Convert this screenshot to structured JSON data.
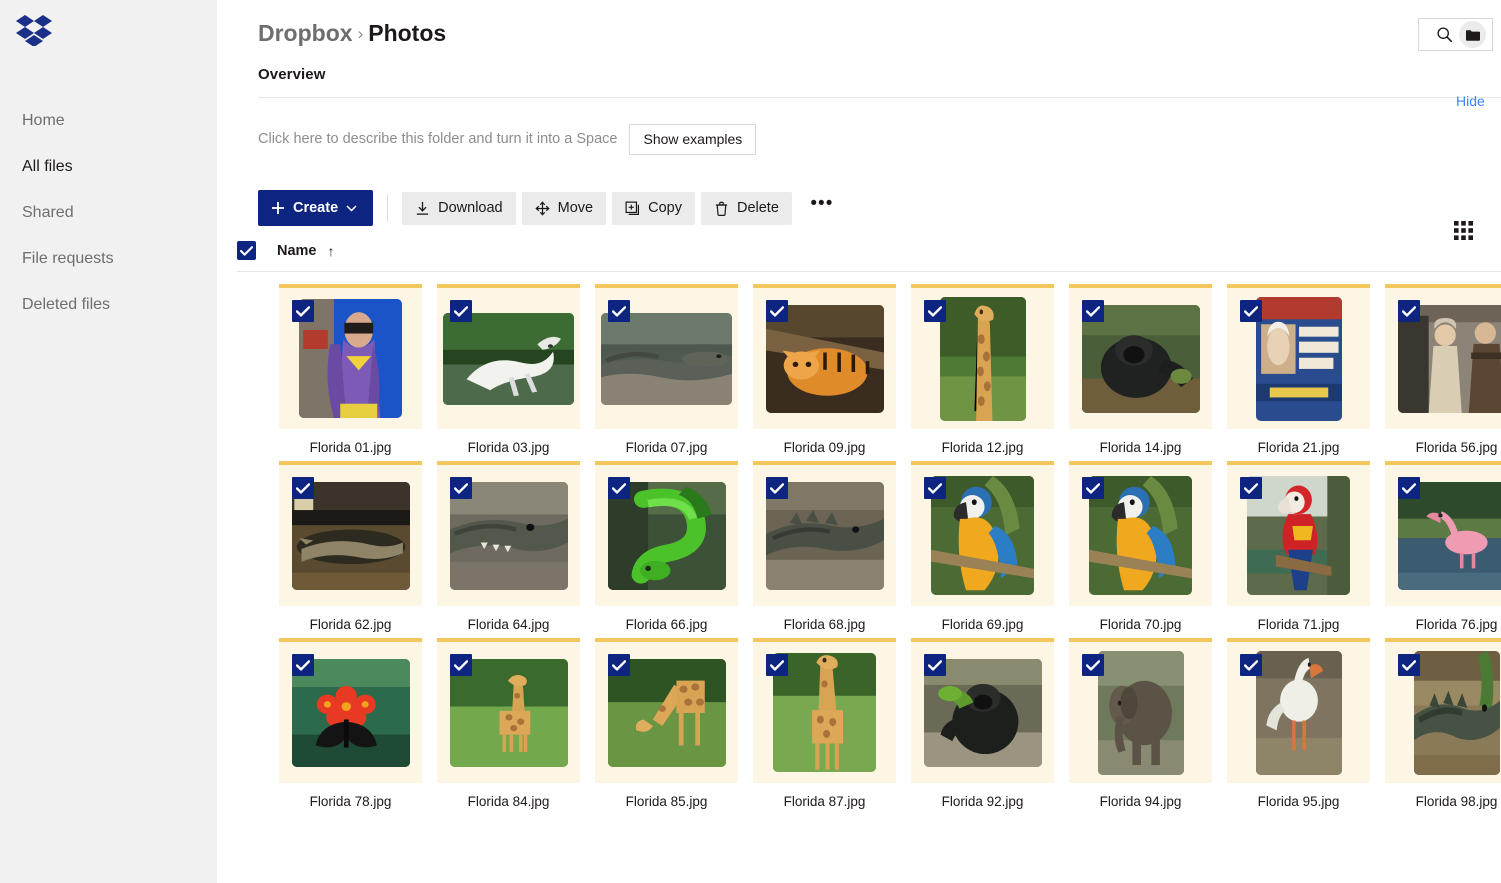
{
  "app": {
    "logo_icon": "dropbox-logo",
    "background": "#ffffff",
    "accent": "#0d2481",
    "link_color": "#3984ff",
    "tile_bg": "#fdf6e4",
    "tile_accent": "#f3c75d"
  },
  "sidebar": {
    "background": "#f1f1f1",
    "items": [
      {
        "label": "Home",
        "active": false
      },
      {
        "label": "All files",
        "active": true
      },
      {
        "label": "Shared",
        "active": false
      },
      {
        "label": "File requests",
        "active": false
      },
      {
        "label": "Deleted files",
        "active": false
      }
    ]
  },
  "header": {
    "breadcrumb": {
      "root": "Dropbox",
      "separator": "›",
      "current": "Photos"
    },
    "actions": [
      {
        "name": "search-icon",
        "label": "Search"
      },
      {
        "name": "folder-icon",
        "label": "Folder"
      }
    ]
  },
  "overview": {
    "title": "Overview",
    "hide_label": "Hide",
    "describe_text": "Click here to describe this folder and turn it into a Space",
    "show_examples_label": "Show examples"
  },
  "toolbar": {
    "create_label": "Create",
    "create_plus": "+",
    "create_caret": "⌄",
    "buttons": [
      {
        "label": "Download",
        "icon": "download-icon"
      },
      {
        "label": "Move",
        "icon": "move-icon"
      },
      {
        "label": "Copy",
        "icon": "copy-icon"
      },
      {
        "label": "Delete",
        "icon": "trash-icon"
      }
    ],
    "more_label": "•••",
    "view_toggle_icon": "grid-view-icon"
  },
  "list_header": {
    "select_all_checked": true,
    "name_label": "Name",
    "sort_arrow": "↑",
    "sort_direction": "ascending"
  },
  "files": [
    {
      "name": "Florida 01.jpg",
      "selected": true,
      "shape": "portrait",
      "subject": "batgirl-mannequin"
    },
    {
      "name": "Florida 03.jpg",
      "selected": true,
      "shape": "wide",
      "subject": "white-dragon-sculpture"
    },
    {
      "name": "Florida 07.jpg",
      "selected": true,
      "shape": "wide",
      "subject": "komodo-dragon"
    },
    {
      "name": "Florida 09.jpg",
      "selected": true,
      "shape": "landscape",
      "subject": "tiger"
    },
    {
      "name": "Florida 12.jpg",
      "selected": true,
      "shape": "tall",
      "subject": "giraffe"
    },
    {
      "name": "Florida 14.jpg",
      "selected": true,
      "shape": "landscape",
      "subject": "gorilla"
    },
    {
      "name": "Florida 21.jpg",
      "selected": true,
      "shape": "tall",
      "subject": "book-cover"
    },
    {
      "name": "Florida 56.jpg",
      "selected": true,
      "shape": "landscape",
      "subject": "costumed-figures"
    },
    {
      "name": "Florida 62.jpg",
      "selected": true,
      "shape": "landscape",
      "subject": "alligator-enclosure"
    },
    {
      "name": "Florida 64.jpg",
      "selected": true,
      "shape": "landscape",
      "subject": "alligator-head"
    },
    {
      "name": "Florida 66.jpg",
      "selected": true,
      "shape": "landscape",
      "subject": "green-tree-python"
    },
    {
      "name": "Florida 68.jpg",
      "selected": true,
      "shape": "landscape",
      "subject": "alligator"
    },
    {
      "name": "Florida 69.jpg",
      "selected": true,
      "shape": "portrait",
      "subject": "blue-gold-macaw"
    },
    {
      "name": "Florida 70.jpg",
      "selected": true,
      "shape": "portrait",
      "subject": "blue-gold-macaw"
    },
    {
      "name": "Florida 71.jpg",
      "selected": true,
      "shape": "portrait",
      "subject": "scarlet-macaw"
    },
    {
      "name": "Florida 76.jpg",
      "selected": true,
      "shape": "landscape",
      "subject": "flamingo"
    },
    {
      "name": "Florida 78.jpg",
      "selected": true,
      "shape": "landscape",
      "subject": "butterfly-on-flowers"
    },
    {
      "name": "Florida 84.jpg",
      "selected": true,
      "shape": "landscape",
      "subject": "giraffe-field"
    },
    {
      "name": "Florida 85.jpg",
      "selected": true,
      "shape": "landscape",
      "subject": "giraffe-grazing"
    },
    {
      "name": "Florida 87.jpg",
      "selected": true,
      "shape": "portrait",
      "subject": "giraffe-standing"
    },
    {
      "name": "Florida 92.jpg",
      "selected": true,
      "shape": "landscape",
      "subject": "gorilla-eating"
    },
    {
      "name": "Florida 94.jpg",
      "selected": true,
      "shape": "tall",
      "subject": "elephant"
    },
    {
      "name": "Florida 95.jpg",
      "selected": true,
      "shape": "tall",
      "subject": "white-ibis"
    },
    {
      "name": "Florida 98.jpg",
      "selected": true,
      "shape": "tall",
      "subject": "crocodile-on-ground"
    }
  ]
}
